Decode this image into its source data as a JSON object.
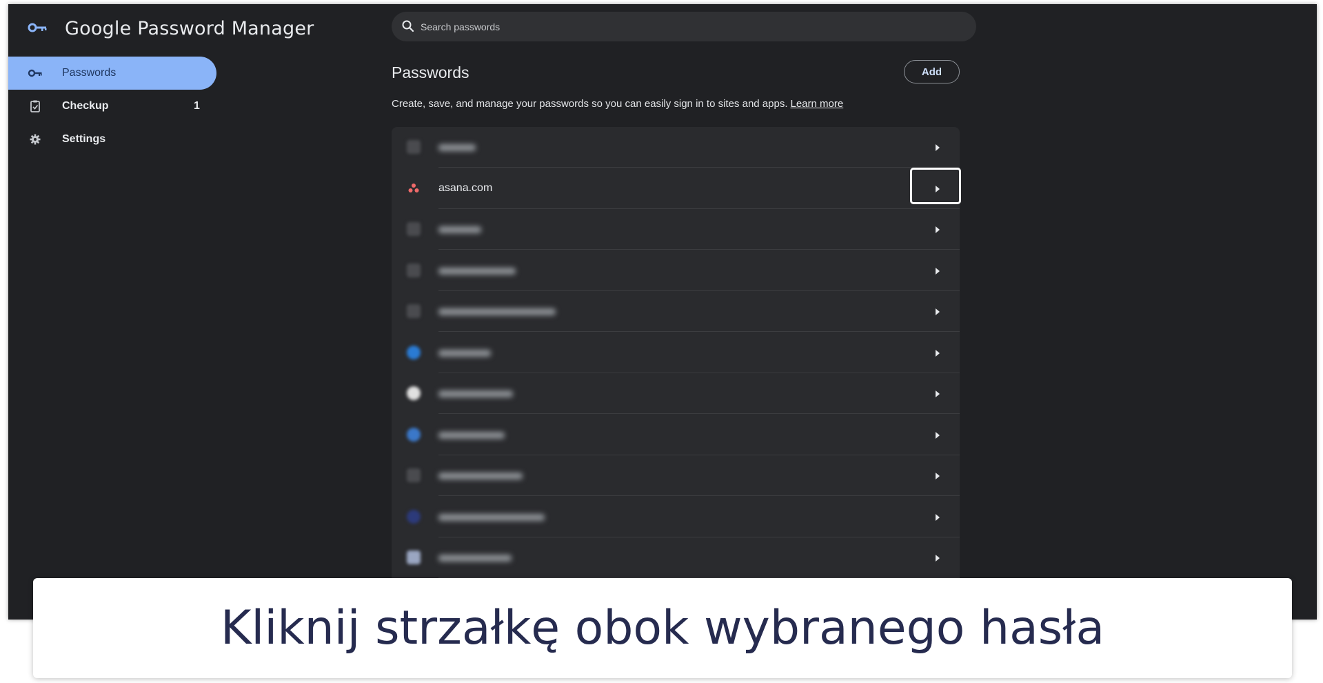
{
  "app": {
    "title": "Google Password Manager",
    "logo_icon": "key-icon"
  },
  "search": {
    "placeholder": "Search passwords",
    "icon": "search-icon"
  },
  "sidebar": {
    "items": [
      {
        "label": "Passwords",
        "icon": "key-icon",
        "active": true,
        "count": ""
      },
      {
        "label": "Checkup",
        "icon": "clipboard-check-icon",
        "active": false,
        "count": "1"
      },
      {
        "label": "Settings",
        "icon": "gear-icon",
        "active": false,
        "count": ""
      }
    ]
  },
  "main": {
    "title": "Passwords",
    "add_label": "Add",
    "description": "Create, save, and manage your passwords so you can easily sign in to sites and apps.",
    "learn_more": "Learn more"
  },
  "list": {
    "rows": [
      {
        "site": "",
        "blurred": true
      },
      {
        "site": "asana.com",
        "blurred": false
      },
      {
        "site": "",
        "blurred": true
      },
      {
        "site": "",
        "blurred": true
      },
      {
        "site": "",
        "blurred": true
      },
      {
        "site": "",
        "blurred": true
      },
      {
        "site": "",
        "blurred": true
      },
      {
        "site": "",
        "blurred": true
      },
      {
        "site": "",
        "blurred": true
      },
      {
        "site": "",
        "blurred": true
      },
      {
        "site": "",
        "blurred": true
      }
    ]
  },
  "caption": {
    "text": "Kliknij strzałkę obok wybranego hasła"
  },
  "colors": {
    "background": "#202124",
    "active_nav": "#8ab4f8",
    "asana_brand": "#f06a6a"
  }
}
